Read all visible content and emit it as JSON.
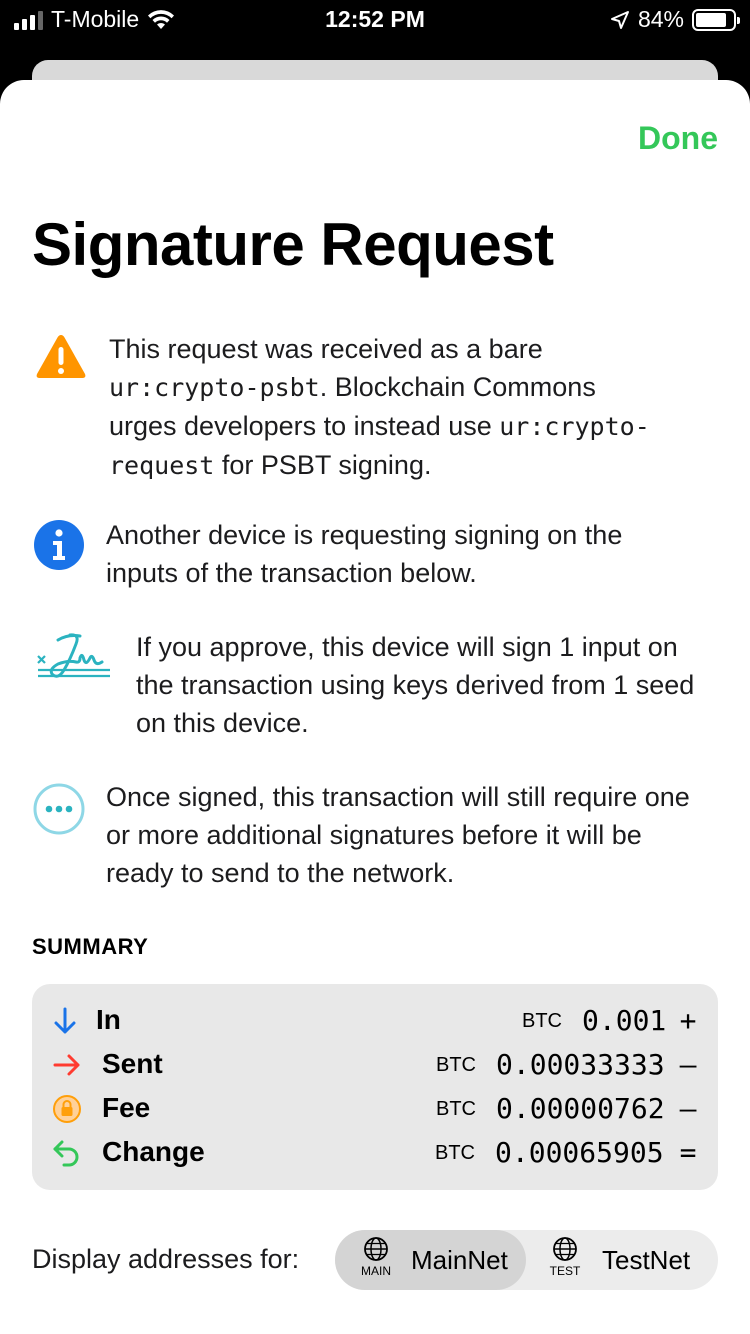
{
  "status_bar": {
    "carrier": "T-Mobile",
    "time": "12:52 PM",
    "battery": "84%"
  },
  "sheet": {
    "done_label": "Done",
    "title": "Signature Request"
  },
  "messages": [
    {
      "icon": "warning-icon",
      "line1": "This request was received as a bare",
      "line2_code": "ur:crypto-psbt",
      "line2_rest": ". Blockchain Commons",
      "line3_text": "urges developers to instead use ",
      "line3_code": "ur:crypto-",
      "line4_code": "request",
      "line4_rest": " for PSBT signing."
    },
    {
      "icon": "info-icon",
      "text": "Another device is requesting signing on the inputs of the transaction below."
    },
    {
      "icon": "signature-icon",
      "text": "If you approve, this device will sign 1 input on the transaction using keys derived from 1 seed on this device."
    },
    {
      "icon": "ellipsis-icon",
      "text": "Once signed, this transaction will still require one or more additional signatures before it will be ready to send to the network."
    }
  ],
  "summary": {
    "heading": "SUMMARY",
    "rows": [
      {
        "label": "In",
        "unit": "BTC",
        "amount": "0.001",
        "symbol": "+",
        "icon": "arrow-down-icon",
        "color": "#1a73e8"
      },
      {
        "label": "Sent",
        "unit": "BTC",
        "amount": "0.00033333",
        "symbol": "–",
        "icon": "arrow-right-icon",
        "color": "#ff3b30"
      },
      {
        "label": "Fee",
        "unit": "BTC",
        "amount": "0.00000762",
        "symbol": "–",
        "icon": "lock-icon",
        "color": "#ff9f0a"
      },
      {
        "label": "Change",
        "unit": "BTC",
        "amount": "0.00065905",
        "symbol": "=",
        "icon": "return-arrow-icon",
        "color": "#34c759"
      }
    ]
  },
  "display_addresses": {
    "label": "Display addresses for:",
    "options": [
      {
        "tiny": "MAIN",
        "label": "MainNet",
        "selected": true
      },
      {
        "tiny": "TEST",
        "label": "TestNet",
        "selected": false
      }
    ]
  },
  "colors": {
    "accent_green": "#34c759",
    "info_blue": "#1a73e8",
    "warning_orange": "#ff9500",
    "signature_teal": "#2bb3c0"
  }
}
